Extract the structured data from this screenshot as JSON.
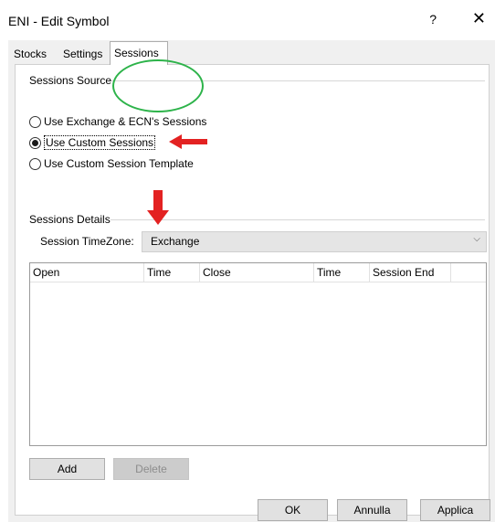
{
  "window": {
    "title": "ENI - Edit Symbol",
    "help_label": "?",
    "close_label": "✕"
  },
  "tabs": [
    {
      "label": "Stocks",
      "active": false
    },
    {
      "label": "Settings",
      "active": false
    },
    {
      "label": "Sessions",
      "active": true
    }
  ],
  "sessions_source": {
    "title": "Sessions Source",
    "options": [
      {
        "label": "Use Exchange & ECN's Sessions",
        "selected": false
      },
      {
        "label": "Use Custom Sessions",
        "selected": true
      },
      {
        "label": "Use Custom Session Template",
        "selected": false
      }
    ]
  },
  "sessions_details": {
    "title": "Sessions Details",
    "timezone_label": "Session TimeZone:",
    "timezone_value": "Exchange"
  },
  "grid": {
    "columns": [
      "Open",
      "Time",
      "Close",
      "Time",
      "Session End"
    ],
    "rows": []
  },
  "actions": {
    "add_label": "Add",
    "delete_label": "Delete"
  },
  "footer": {
    "ok_label": "OK",
    "cancel_label": "Annulla",
    "apply_label": "Applica"
  },
  "annotations": {
    "highlight_color": "#2db34a",
    "arrow_color": "#e32222"
  }
}
